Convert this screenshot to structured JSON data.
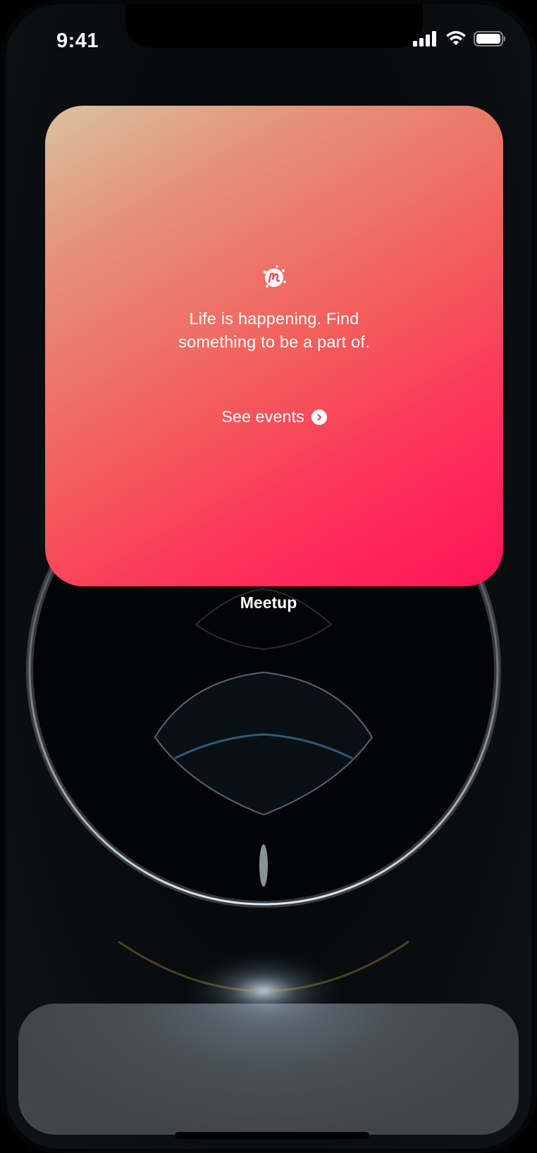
{
  "status_bar": {
    "time": "9:41"
  },
  "widget": {
    "app_name": "Meetup",
    "headline_line1": "Life is happening. Find",
    "headline_line2": "something to be a part of.",
    "cta_label": "See events",
    "logo_icon": "meetup-logo-icon",
    "gradient_colors": [
      "#d9c39e",
      "#f35e5b",
      "#ff1458"
    ]
  },
  "dock": {
    "items": []
  }
}
